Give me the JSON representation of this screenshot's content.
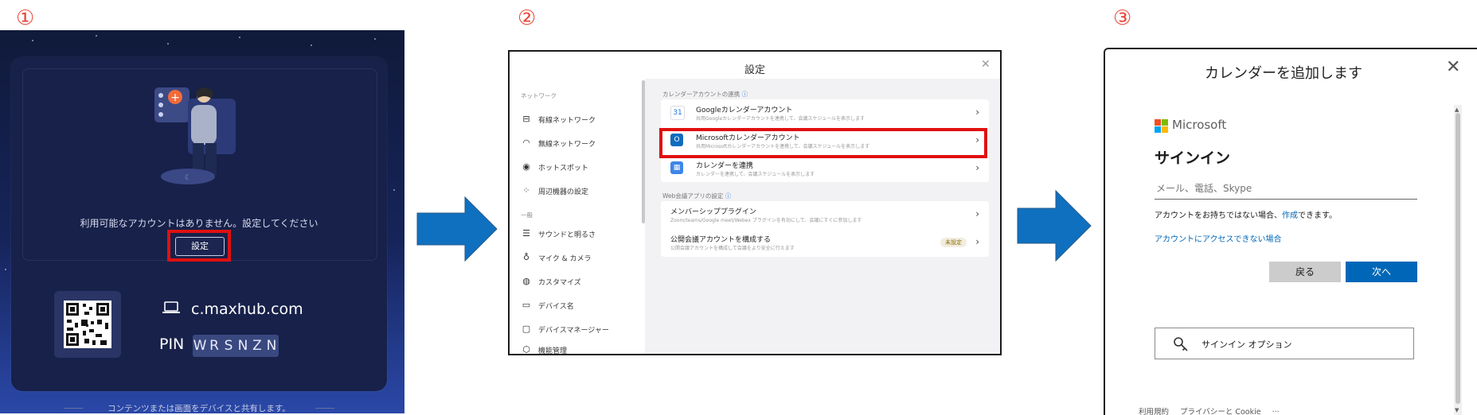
{
  "steps": [
    "①",
    "②",
    "③"
  ],
  "panel1": {
    "message": "利用可能なアカウントはありません。設定してください",
    "settings_button": "設定",
    "site": "c.maxhub.com",
    "pin_label": "PIN",
    "pin": [
      "W",
      "R",
      "S",
      "N",
      "Z",
      "N"
    ],
    "share_text": "コンテンツまたは画面をデバイスと共有します。"
  },
  "panel2": {
    "title": "設定",
    "sidebar": {
      "network_header": "ネットワーク",
      "network_items": [
        "有線ネットワーク",
        "無線ネットワーク",
        "ホットスポット",
        "周辺機器の設定"
      ],
      "general_header": "一般",
      "general_items": [
        "サウンドと明るさ",
        "マイク & カメラ",
        "カスタマイズ",
        "デバイス名",
        "デバイスマネージャー",
        "機能管理"
      ]
    },
    "calendar_section": "カレンダーアカウントの連携",
    "calendar_rows": [
      {
        "title": "Googleカレンダーアカウント",
        "sub": "共用Googleカレンダーアカウントを連携して、会議スケジュールを表示します"
      },
      {
        "title": "Microsoftカレンダーアカウント",
        "sub": "共用Microsoftカレンダーアカウントを連携して、会議スケジュールを表示します"
      },
      {
        "title": "カレンダーを連携",
        "sub": "カレンダーを連携して、会議スケジュールを表示します"
      }
    ],
    "web_section": "Web会議アプリの設定",
    "web_rows": [
      {
        "title": "メンバーシッププラグイン",
        "sub": "Zoom/teams/Google meet/Webex プラグインを有効にして、会議にすぐに参加します"
      },
      {
        "title": "公開会議アカウントを構成する",
        "sub": "公開会議アカウントを構成して会議をより安全に行えます",
        "tag": "未設定"
      }
    ]
  },
  "panel3": {
    "title": "カレンダーを追加します",
    "brand": "Microsoft",
    "heading": "サインイン",
    "email_placeholder": "メール、電話、Skype",
    "no_account_prefix": "アカウントをお持ちではない場合、",
    "create_link": "作成",
    "no_account_suffix": "できます。",
    "cant_access": "アカウントにアクセスできない場合",
    "back_button": "戻る",
    "next_button": "次へ",
    "signin_options": "サインイン オプション",
    "footer": [
      "利用規約",
      "プライバシーと Cookie",
      "..."
    ]
  },
  "colors": {
    "highlight": "#e01010",
    "arrow": "#1070c0",
    "ms_blue": "#0067b8",
    "ms_logo": [
      "#f25022",
      "#7fba00",
      "#00a4ef",
      "#ffb900"
    ]
  }
}
